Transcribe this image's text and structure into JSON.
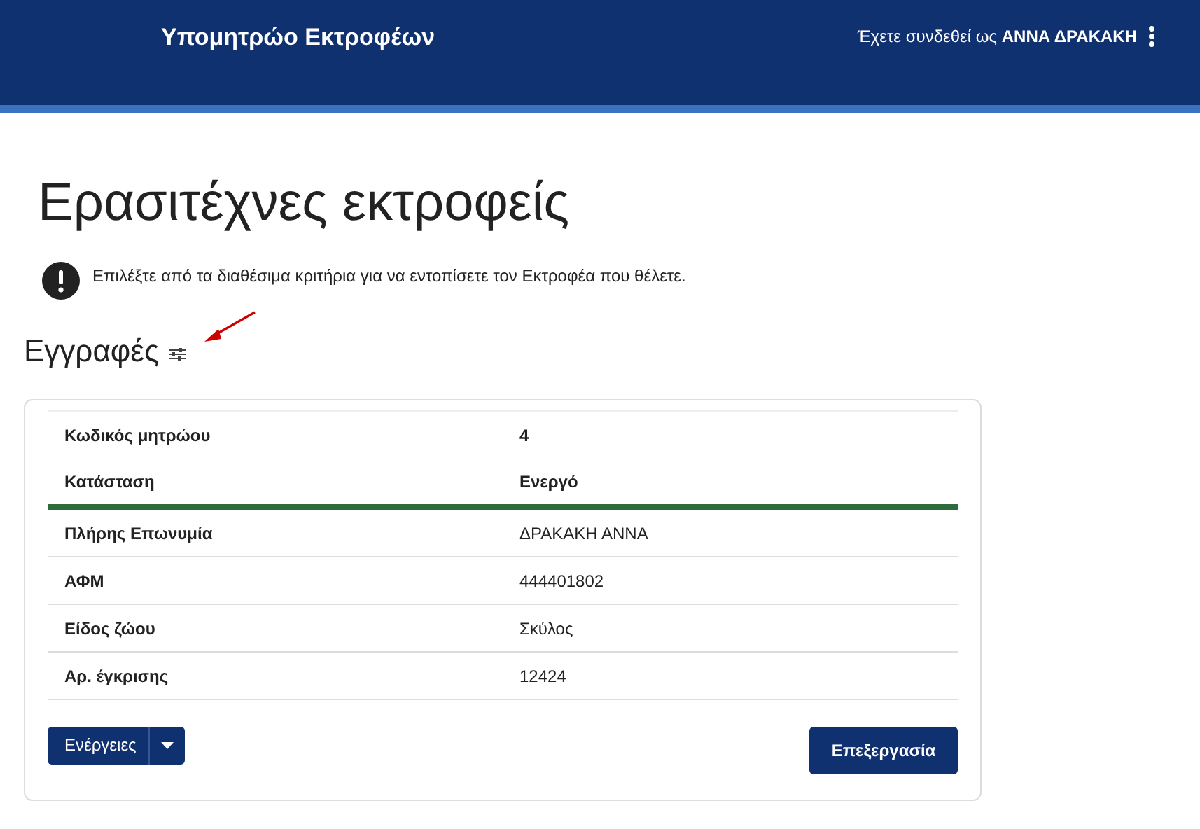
{
  "header": {
    "title": "Υπομητρώο Εκτροφέων",
    "user": "Έχετε συνδεθεί ως **ΑΝΝΑ ΔΡΑΚΑΚΗ**"
  },
  "page": {
    "title": "Ερασιτέχνες εκτροφείς",
    "info": "Επιλέξτε από τα διαθέσιμα κριτήρια για να εντοπίσετε τον Εκτροφέα που θέλετε.",
    "section": "Εγγραφές"
  },
  "record": {
    "rows": [
      {
        "kind": "summary",
        "label": "Κωδικός μητρώου",
        "value": "4"
      },
      {
        "kind": "summary",
        "label": "Κατάσταση",
        "value": "Ενεργό"
      },
      {
        "kind": "detail",
        "label": "Πλήρης Επωνυμία",
        "value": "ΔΡΑΚΑΚΗ ΑΝΝΑ"
      },
      {
        "kind": "detail",
        "label": "ΑΦΜ",
        "value": "444401802"
      },
      {
        "kind": "detail",
        "label": "Είδος ζώου",
        "value": "Σκύλος"
      },
      {
        "kind": "detail",
        "label": "Αρ. έγκρισης",
        "value": "12424"
      }
    ],
    "actions_button": "Ενέργειες",
    "edit_button": "Επεξεργασία"
  }
}
